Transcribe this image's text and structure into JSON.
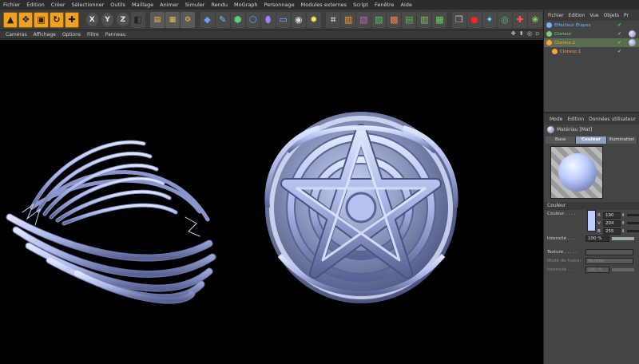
{
  "menubar": [
    "Fichier",
    "Édition",
    "Créer",
    "Sélectionner",
    "Outils",
    "Maillage",
    "Animer",
    "Simuler",
    "Rendu",
    "MoGraph",
    "Personnage",
    "Modules externes",
    "Script",
    "Fenêtre",
    "Aide"
  ],
  "toolbar": {
    "axis_x": "X",
    "axis_y": "Y",
    "axis_z": "Z"
  },
  "viewport_menu": [
    "Caméras",
    "Affichage",
    "Options",
    "Filtre",
    "Panneau"
  ],
  "viewport_icons": "✥ ⬍ ◎ ▫",
  "object_manager": {
    "menu": [
      "Fichier",
      "Edition",
      "Vue",
      "Objets",
      "Pr"
    ],
    "rows": [
      {
        "label": "Effecteur Étapes",
        "color": "#7ab0ff",
        "selected": false
      },
      {
        "label": "Cloneur",
        "color": "#7ad07a",
        "selected": false
      },
      {
        "label": "Cloneur.2",
        "color": "#ffa040",
        "selected": true
      },
      {
        "label": "Cloneur.1",
        "color": "#ffa040",
        "selected": false
      }
    ]
  },
  "attributes": {
    "menu": [
      "Mode",
      "Edition",
      "Données utilisateur"
    ],
    "material_title": "Matériau [Mat]",
    "tabs": [
      {
        "label": "Base",
        "active": false
      },
      {
        "label": "Couleur",
        "active": true
      },
      {
        "label": "Illumination",
        "active": false
      }
    ],
    "section": "Couleur",
    "couleur_label": "Couleur . . . .",
    "r_label": "R",
    "r_value": "190",
    "v_label": "V",
    "v_value": "204",
    "b_label": "B",
    "b_value": "255",
    "color_hex": "#becfff",
    "intensite_label": "Intensité . . .",
    "intensite_value": "100 %",
    "texture_label": "Texture . . . . .",
    "fusion_label": "Mode de fusion",
    "fusion_value": "Normal",
    "intensite2_label": "Intensité . . .",
    "intensite2_value": "100 %"
  }
}
